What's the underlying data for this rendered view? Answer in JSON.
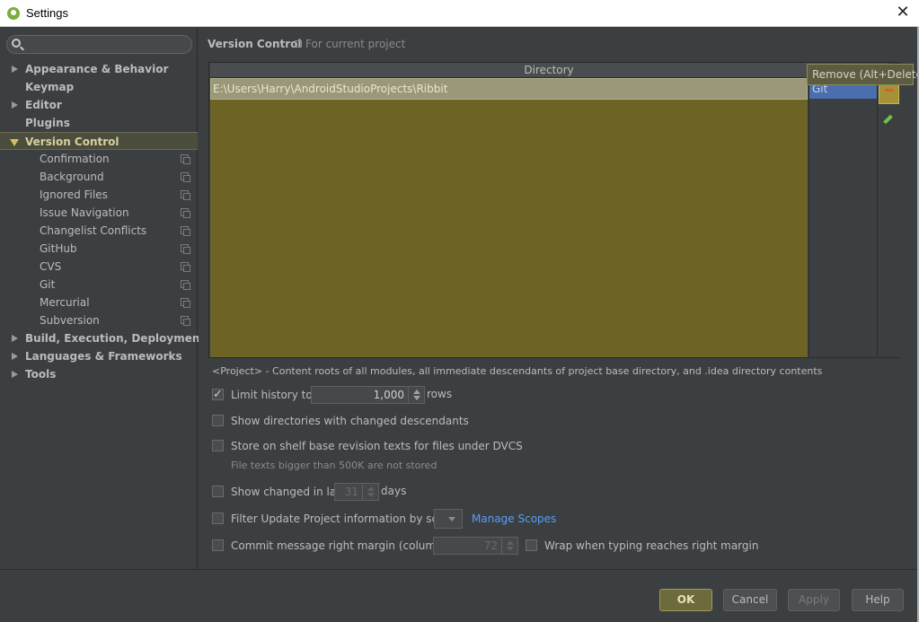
{
  "window": {
    "title": "Settings"
  },
  "search": {
    "placeholder": ""
  },
  "sidebar": {
    "items": [
      {
        "label": "Appearance & Behavior",
        "expandable": true
      },
      {
        "label": "Keymap",
        "expandable": false
      },
      {
        "label": "Editor",
        "expandable": true
      },
      {
        "label": "Plugins",
        "expandable": false
      },
      {
        "label": "Version Control",
        "expanded": true,
        "selected": true
      },
      {
        "label": "Confirmation",
        "child": true
      },
      {
        "label": "Background",
        "child": true
      },
      {
        "label": "Ignored Files",
        "child": true
      },
      {
        "label": "Issue Navigation",
        "child": true
      },
      {
        "label": "Changelist Conflicts",
        "child": true
      },
      {
        "label": "GitHub",
        "child": true
      },
      {
        "label": "CVS",
        "child": true
      },
      {
        "label": "Git",
        "child": true
      },
      {
        "label": "Mercurial",
        "child": true
      },
      {
        "label": "Subversion",
        "child": true
      },
      {
        "label": "Build, Execution, Deployment",
        "expandable": true
      },
      {
        "label": "Languages & Frameworks",
        "expandable": true
      },
      {
        "label": "Tools",
        "expandable": true
      }
    ]
  },
  "main": {
    "title": "Version Control",
    "subtitle": "For current project",
    "table": {
      "column": "Directory",
      "rows": [
        {
          "directory": "E:\\Users\\Harry\\AndroidStudioProjects\\Ribbit",
          "vcs": "Git"
        }
      ]
    },
    "tooltip": "Remove (Alt+Delete)",
    "help_text": "<Project> - Content roots of all modules, all immediate descendants of project base directory, and .idea directory contents",
    "options": {
      "limit_history": {
        "label": "Limit history to:",
        "value": "1,000",
        "suffix": "rows",
        "checked": true
      },
      "show_dirs": {
        "label": "Show directories with changed descendants",
        "checked": false
      },
      "store_shelf": {
        "label": "Store on shelf base revision texts for files under DVCS",
        "checked": false,
        "note": "File texts bigger than 500K are not stored"
      },
      "show_changed": {
        "label": "Show changed in last",
        "value": "31",
        "suffix": "days",
        "checked": false
      },
      "filter_update": {
        "label": "Filter Update Project information by scope",
        "checked": false,
        "link": "Manage Scopes"
      },
      "commit_margin": {
        "label": "Commit message right margin (columns):",
        "value": "72",
        "checked": false
      },
      "wrap": {
        "label": "Wrap when typing reaches right margin",
        "checked": false
      }
    }
  },
  "buttons": {
    "ok": "OK",
    "cancel": "Cancel",
    "apply": "Apply",
    "help": "Help"
  },
  "colors": {
    "accent": "#a69236",
    "selection": "#4b6eaf",
    "link": "#589df6"
  }
}
